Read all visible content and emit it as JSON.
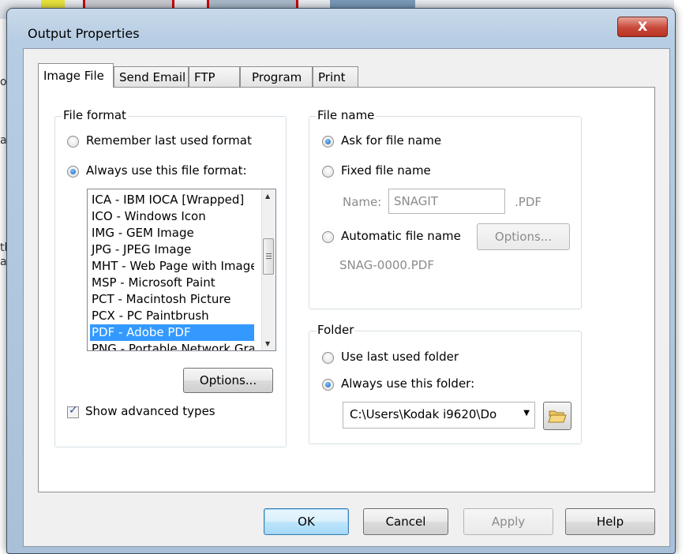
{
  "window": {
    "title": "Output Properties",
    "close_glyph": "X"
  },
  "background": {
    "fragments": [
      "or",
      "ap",
      "th",
      "ay"
    ]
  },
  "tabs": [
    {
      "label": "Image File"
    },
    {
      "label": "Send Email"
    },
    {
      "label": "FTP"
    },
    {
      "label": "Program"
    },
    {
      "label": "Print"
    }
  ],
  "file_format": {
    "label": "File format",
    "remember_label": "Remember last used format",
    "always_label": "Always use this file format:",
    "selected": "always",
    "formats": [
      {
        "label": "ICA - IBM IOCA [Wrapped]"
      },
      {
        "label": "ICO - Windows Icon"
      },
      {
        "label": "IMG - GEM Image"
      },
      {
        "label": "JPG - JPEG Image"
      },
      {
        "label": "MHT - Web Page with Image"
      },
      {
        "label": "MSP - Microsoft Paint"
      },
      {
        "label": "PCT - Macintosh Picture"
      },
      {
        "label": "PCX - PC Paintbrush"
      },
      {
        "label": "PDF - Adobe PDF"
      },
      {
        "label": "PNG - Portable Network Graphics"
      }
    ],
    "selected_format": "PDF - Adobe PDF",
    "options_label": "Options...",
    "show_advanced_label": "Show advanced types",
    "show_advanced_checked": true
  },
  "file_name": {
    "label": "File name",
    "ask_label": "Ask for file name",
    "fixed_label": "Fixed file name",
    "name_label": "Name:",
    "name_value": "SNAGIT",
    "extension": ".PDF",
    "automatic_label": "Automatic file name",
    "options_label": "Options...",
    "auto_example": "SNAG-0000.PDF",
    "selected": "ask"
  },
  "folder": {
    "label": "Folder",
    "last_used_label": "Use last used folder",
    "always_label": "Always use this folder:",
    "selected": "always",
    "path": "C:\\Users\\Kodak i9620\\Do"
  },
  "buttons": {
    "ok": "OK",
    "cancel": "Cancel",
    "apply": "Apply",
    "help": "Help"
  },
  "colors": {
    "selection": "#3399ff",
    "close": "#c9483a",
    "frame": "#b7cde3"
  }
}
